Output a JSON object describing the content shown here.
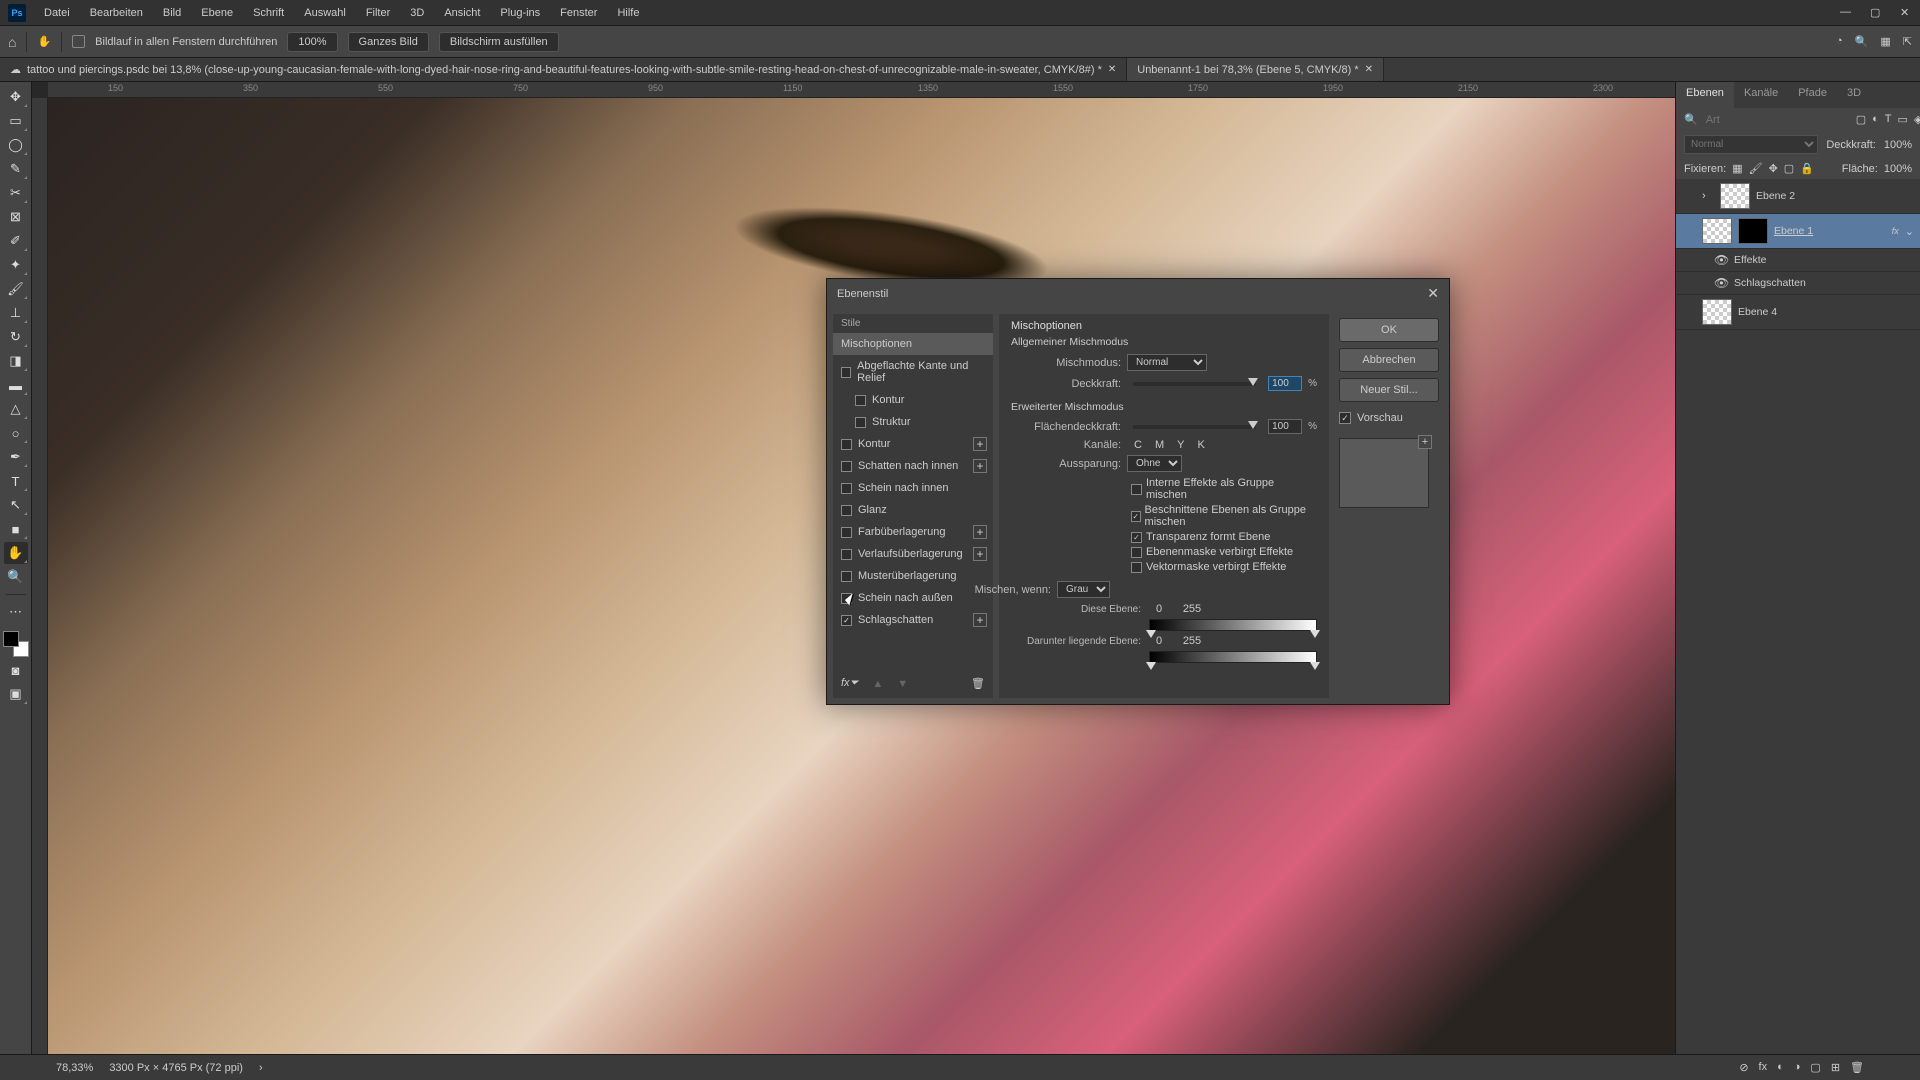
{
  "menu": {
    "items": [
      "Datei",
      "Bearbeiten",
      "Bild",
      "Ebene",
      "Schrift",
      "Auswahl",
      "Filter",
      "3D",
      "Ansicht",
      "Plug-ins",
      "Fenster",
      "Hilfe"
    ]
  },
  "optbar": {
    "scroll_all": "Bildlauf in allen Fenstern durchführen",
    "zoom": "100%",
    "fit": "Ganzes Bild",
    "fill": "Bildschirm ausfüllen"
  },
  "tabs": {
    "t1": "tattoo und piercings.psdc bei 13,8% (close-up-young-caucasian-female-with-long-dyed-hair-nose-ring-and-beautiful-features-looking-with-subtle-smile-resting-head-on-chest-of-unrecognizable-male-in-sweater, CMYK/8#) *",
    "t2": "Unbenannt-1 bei 78,3% (Ebene 5, CMYK/8) *"
  },
  "ruler_ticks": [
    "150",
    "350",
    "550",
    "750",
    "950",
    "1150",
    "1350",
    "1550",
    "1750",
    "1950",
    "2150",
    "2300"
  ],
  "panels": {
    "tabs": [
      "Ebenen",
      "Kanäle",
      "Pfade",
      "3D"
    ],
    "search_ph": "Art",
    "blend": "Normal",
    "opacity_lbl": "Deckkraft:",
    "opacity_val": "100%",
    "lock_lbl": "Fixieren:",
    "fill_lbl": "Fläche:",
    "fill_val": "100%",
    "layers": [
      {
        "name": "Ebene 2"
      },
      {
        "name": "Ebene 1",
        "selected": true,
        "mask": true,
        "fx": "fx"
      },
      {
        "name": "Effekte",
        "sub": true
      },
      {
        "name": "Schlagschatten",
        "sub": true
      },
      {
        "name": "Ebene 4"
      }
    ]
  },
  "status": {
    "zoom": "78,33%",
    "doc": "3300 Px × 4765 Px (72 ppi)"
  },
  "dialog": {
    "title": "Ebenenstil",
    "stile_hdr": "Stile",
    "rows": {
      "blend_opts": "Mischoptionen",
      "bevel": "Abgeflachte Kante und Relief",
      "contour": "Kontur",
      "texture": "Struktur",
      "stroke": "Kontur",
      "inner_shadow": "Schatten nach innen",
      "inner_glow": "Schein nach innen",
      "satin": "Glanz",
      "color_ov": "Farbüberlagerung",
      "grad_ov": "Verlaufsüberlagerung",
      "pat_ov": "Musterüberlagerung",
      "outer_glow": "Schein nach außen",
      "drop_shadow": "Schlagschatten"
    },
    "opts": {
      "title": "Mischoptionen",
      "general": "Allgemeiner Mischmodus",
      "mode_lbl": "Mischmodus:",
      "mode_val": "Normal",
      "opacity_lbl": "Deckkraft:",
      "opacity_val": "100",
      "pct": "%",
      "adv": "Erweiterter Mischmodus",
      "fill_lbl": "Flächendeckkraft:",
      "fill_val": "100",
      "chan_lbl": "Kanäle:",
      "chans": [
        "C",
        "M",
        "Y",
        "K"
      ],
      "knock_lbl": "Aussparung:",
      "knock_val": "Ohne",
      "chk1": "Interne Effekte als Gruppe mischen",
      "chk2": "Beschnittene Ebenen als Gruppe mischen",
      "chk3": "Transparenz formt Ebene",
      "chk4": "Ebenenmaske verbirgt Effekte",
      "chk5": "Vektormaske verbirgt Effekte",
      "blendif_lbl": "Mischen, wenn:",
      "blendif_val": "Grau",
      "this_lbl": "Diese Ebene:",
      "this_lo": "0",
      "this_hi": "255",
      "under_lbl": "Darunter liegende Ebene:",
      "under_lo": "0",
      "under_hi": "255"
    },
    "btns": {
      "ok": "OK",
      "cancel": "Abbrechen",
      "new": "Neuer Stil...",
      "preview": "Vorschau"
    }
  }
}
